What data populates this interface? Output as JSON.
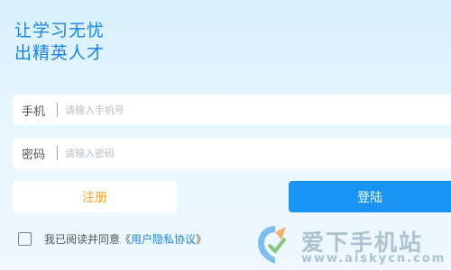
{
  "slogan": {
    "line1": "让学习无忧",
    "line2": "出精英人才"
  },
  "form": {
    "phone_label": "手机",
    "phone_placeholder": "请输入手机号",
    "phone_value": "",
    "password_label": "密码",
    "password_placeholder": "请输入密码",
    "password_value": ""
  },
  "actions": {
    "register_label": "注册",
    "login_label": "登陆"
  },
  "agreement": {
    "prefix": "我已阅读并同意《",
    "link": "用户隐私协议",
    "suffix": "》",
    "checked": false
  },
  "watermark": {
    "brand": "爱下手机站",
    "url": "www.aiskycn.com"
  },
  "colors": {
    "accent": "#1a84e6",
    "login_button": "#1a94f4",
    "register_text": "#f6a623"
  }
}
